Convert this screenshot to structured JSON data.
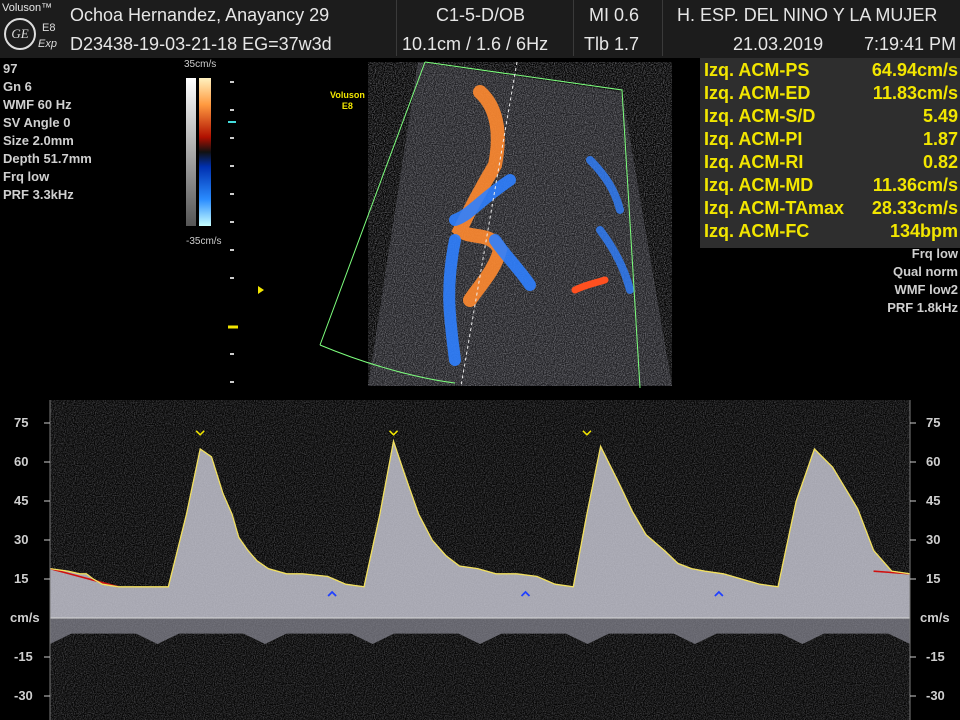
{
  "header": {
    "brand": "Voluson™",
    "logo_model": "E8",
    "logo_sub": "Exp",
    "logo_mark": "GE",
    "patient": "Ochoa Hernandez, Anayancy  29",
    "probe": "C1-5-D/OB",
    "mi": "MI  0.6",
    "hospital": "H. ESP. DEL NINO Y LA MUJER",
    "exam_id": "D23438-19-03-21-18  EG=37w3d",
    "depth_freq": "10.1cm / 1.6 /  6Hz",
    "tib": "Tlb  1.7",
    "date": "21.03.2019",
    "time": "7:19:41 PM"
  },
  "left_params": [
    "97",
    "Gn  6",
    "WMF 60 Hz",
    "SV Angle  0",
    "Size  2.0mm",
    "Depth 51.7mm",
    "Frq low",
    "PRF  3.3kHz"
  ],
  "color_bar": {
    "top_label": "35cm/s",
    "bottom_label": "-35cm/s"
  },
  "image_label": {
    "line1": "Voluson",
    "line2": "E8"
  },
  "measurements": [
    {
      "key": "Izq. ACM-PS",
      "value": "64.94cm/s"
    },
    {
      "key": "Izq. ACM-ED",
      "value": "11.83cm/s"
    },
    {
      "key": "Izq. ACM-S/D",
      "value": "5.49"
    },
    {
      "key": "Izq. ACM-PI",
      "value": "1.87"
    },
    {
      "key": "Izq. ACM-RI",
      "value": "0.82"
    },
    {
      "key": "Izq. ACM-MD",
      "value": "11.36cm/s"
    },
    {
      "key": "Izq. ACM-TAmax",
      "value": "28.33cm/s"
    },
    {
      "key": "Izq. ACM-FC",
      "value": "134bpm"
    }
  ],
  "right_params": [
    "Frq low",
    "Qual norm",
    "WMF low2",
    "PRF  1.8kHz"
  ],
  "doppler_scale": {
    "unit": "cm/s",
    "ticks": [
      75,
      60,
      45,
      30,
      15,
      -15,
      -30
    ]
  },
  "chart_data": {
    "type": "line",
    "title": "",
    "xlabel": "",
    "ylabel": "cm/s",
    "ylim": [
      -35,
      80
    ],
    "series": [
      {
        "x": [
          0,
          0.08,
          0.13,
          0.16,
          0.19,
          0.23,
          0.3,
          0.4,
          0.52,
          0.6,
          0.66,
          0.71,
          0.76,
          0.8,
          0.83,
          0.87,
          0.91,
          0.96,
          1.04,
          1.11,
          1.22,
          1.3,
          1.38,
          1.45,
          1.51,
          1.56,
          1.62,
          1.68,
          1.74,
          1.8,
          1.88,
          1.96,
          2.05,
          2.14,
          2.22,
          2.3,
          2.36,
          2.42,
          2.5,
          2.56,
          2.62,
          2.7,
          2.76,
          2.82,
          2.88,
          2.96,
          3.04,
          3.12,
          3.2,
          3.28,
          3.36,
          3.44,
          3.55,
          3.62,
          3.7,
          3.78
        ],
        "values": [
          19,
          18,
          17,
          17,
          15,
          13,
          12,
          12,
          12,
          40,
          65,
          62,
          48,
          40,
          31,
          26,
          22,
          19,
          17,
          17,
          16,
          13,
          12,
          40,
          68,
          55,
          40,
          30,
          24,
          20,
          19,
          17,
          17,
          16,
          13,
          12,
          40,
          66,
          52,
          41,
          32,
          26,
          21,
          19,
          18,
          17,
          15,
          13,
          12,
          45,
          65,
          58,
          42,
          26,
          18,
          17
        ]
      }
    ],
    "peak_markers": [
      0.66,
      1.51,
      2.36
    ],
    "trough_markers": [
      1.24,
      2.09,
      2.94
    ]
  }
}
